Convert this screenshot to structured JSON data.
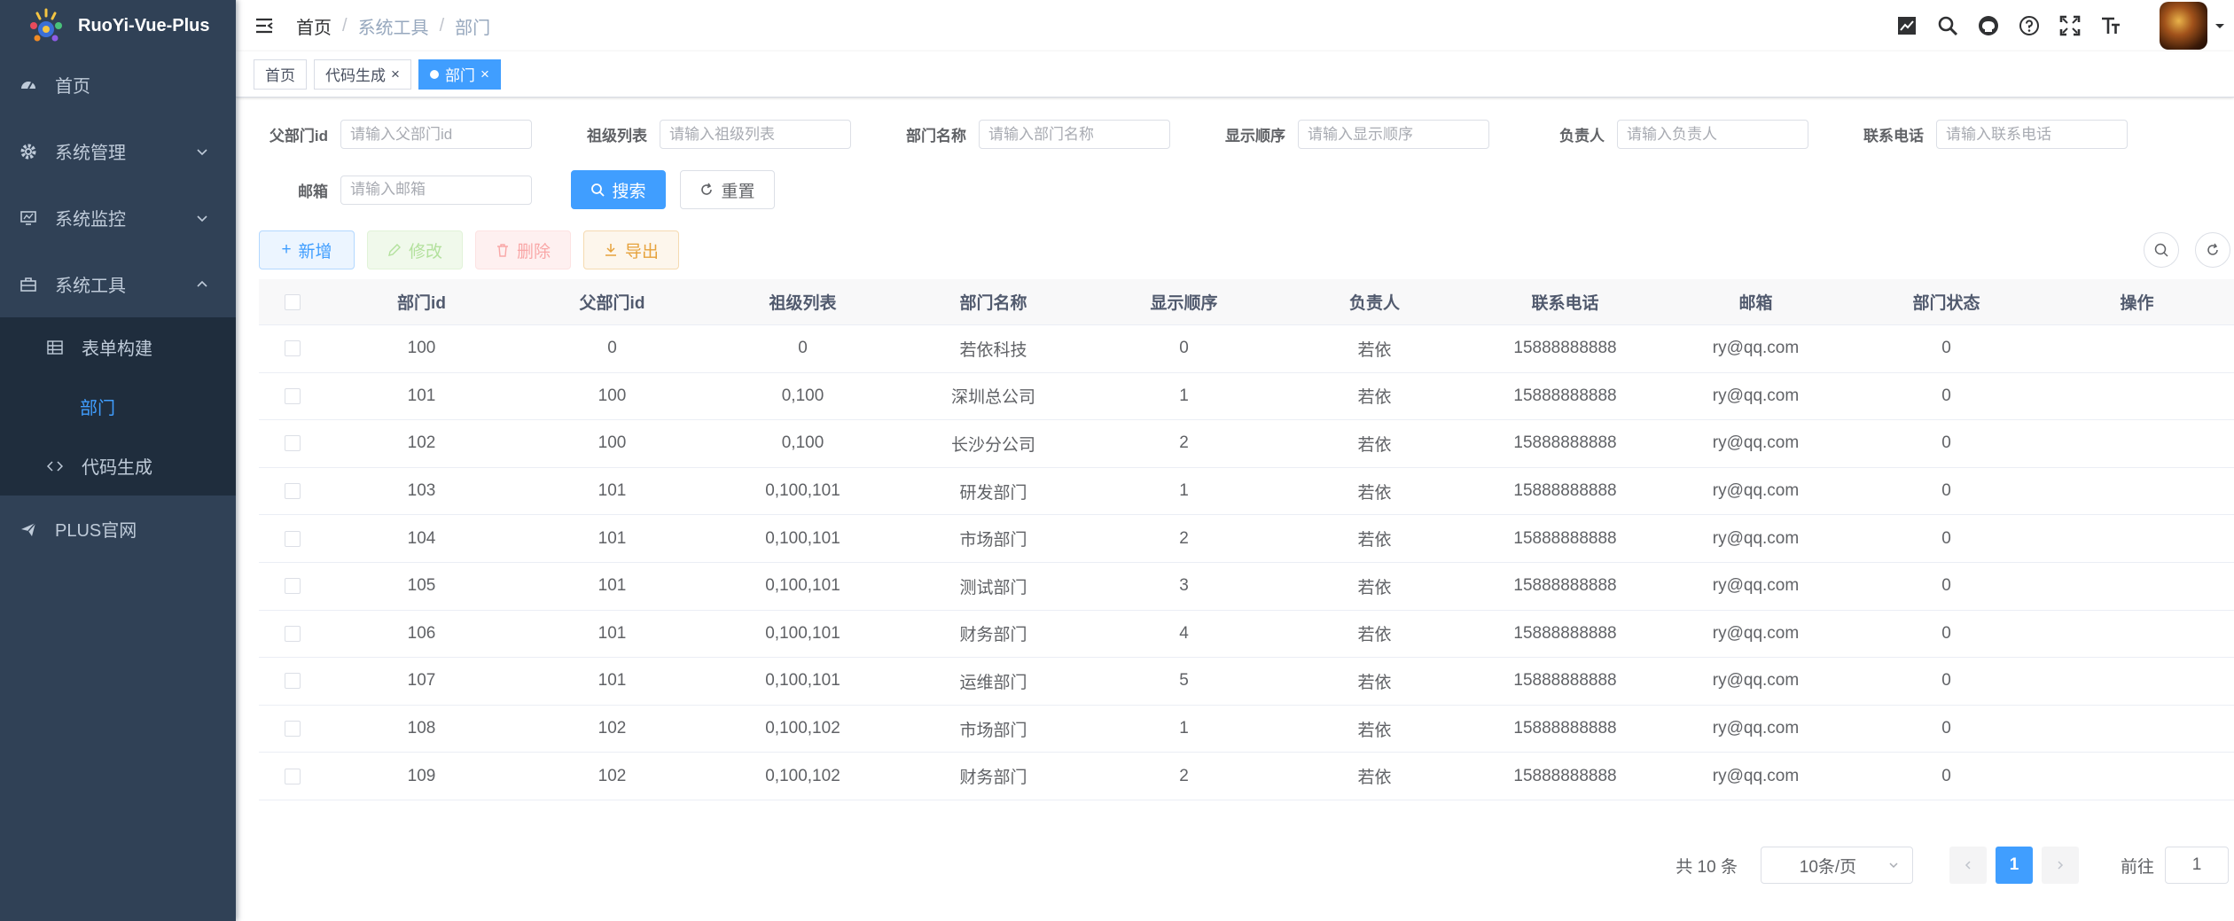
{
  "app": {
    "title": "RuoYi-Vue-Plus"
  },
  "sidebar": {
    "items": [
      {
        "label": "首页",
        "icon": "dashboard-icon"
      },
      {
        "label": "系统管理",
        "icon": "gear-icon"
      },
      {
        "label": "系统监控",
        "icon": "monitor-icon"
      },
      {
        "label": "系统工具",
        "icon": "toolbox-icon"
      }
    ],
    "submenu": [
      {
        "label": "表单构建",
        "icon": "grid-icon"
      },
      {
        "label": "部门"
      },
      {
        "label": "代码生成",
        "icon": "code-icon"
      }
    ],
    "external": {
      "label": "PLUS官网",
      "icon": "send-icon"
    }
  },
  "breadcrumb": [
    "首页",
    "系统工具",
    "部门"
  ],
  "tags": [
    {
      "label": "首页",
      "close": ""
    },
    {
      "label": "代码生成",
      "close": "×"
    },
    {
      "label": "部门",
      "close": "×"
    }
  ],
  "search_form": {
    "fields": [
      {
        "label": "父部门id",
        "placeholder": "请输入父部门id"
      },
      {
        "label": "祖级列表",
        "placeholder": "请输入祖级列表"
      },
      {
        "label": "部门名称",
        "placeholder": "请输入部门名称"
      },
      {
        "label": "显示顺序",
        "placeholder": "请输入显示顺序"
      },
      {
        "label": "负责人",
        "placeholder": "请输入负责人"
      },
      {
        "label": "联系电话",
        "placeholder": "请输入联系电话"
      },
      {
        "label": "邮箱",
        "placeholder": "请输入邮箱"
      }
    ],
    "search_label": "搜索",
    "reset_label": "重置"
  },
  "toolbar": {
    "add": "新增",
    "edit": "修改",
    "delete": "删除",
    "export": "导出"
  },
  "table": {
    "headers": [
      "部门id",
      "父部门id",
      "祖级列表",
      "部门名称",
      "显示顺序",
      "负责人",
      "联系电话",
      "邮箱",
      "部门状态",
      "操作"
    ],
    "rows": [
      [
        "100",
        "0",
        "0",
        "若依科技",
        "0",
        "若依",
        "15888888888",
        "ry@qq.com",
        "0"
      ],
      [
        "101",
        "100",
        "0,100",
        "深圳总公司",
        "1",
        "若依",
        "15888888888",
        "ry@qq.com",
        "0"
      ],
      [
        "102",
        "100",
        "0,100",
        "长沙分公司",
        "2",
        "若依",
        "15888888888",
        "ry@qq.com",
        "0"
      ],
      [
        "103",
        "101",
        "0,100,101",
        "研发部门",
        "1",
        "若依",
        "15888888888",
        "ry@qq.com",
        "0"
      ],
      [
        "104",
        "101",
        "0,100,101",
        "市场部门",
        "2",
        "若依",
        "15888888888",
        "ry@qq.com",
        "0"
      ],
      [
        "105",
        "101",
        "0,100,101",
        "测试部门",
        "3",
        "若依",
        "15888888888",
        "ry@qq.com",
        "0"
      ],
      [
        "106",
        "101",
        "0,100,101",
        "财务部门",
        "4",
        "若依",
        "15888888888",
        "ry@qq.com",
        "0"
      ],
      [
        "107",
        "101",
        "0,100,101",
        "运维部门",
        "5",
        "若依",
        "15888888888",
        "ry@qq.com",
        "0"
      ],
      [
        "108",
        "102",
        "0,100,102",
        "市场部门",
        "1",
        "若依",
        "15888888888",
        "ry@qq.com",
        "0"
      ],
      [
        "109",
        "102",
        "0,100,102",
        "财务部门",
        "2",
        "若依",
        "15888888888",
        "ry@qq.com",
        "0"
      ]
    ]
  },
  "pagination": {
    "total": "共 10 条",
    "page_size": "10条/页",
    "current": "1",
    "goto_label": "前往",
    "goto_value": "1"
  },
  "colors": {
    "primary": "#409eff",
    "sidebar_bg": "#304156",
    "submenu_bg": "#1f2d3d"
  }
}
